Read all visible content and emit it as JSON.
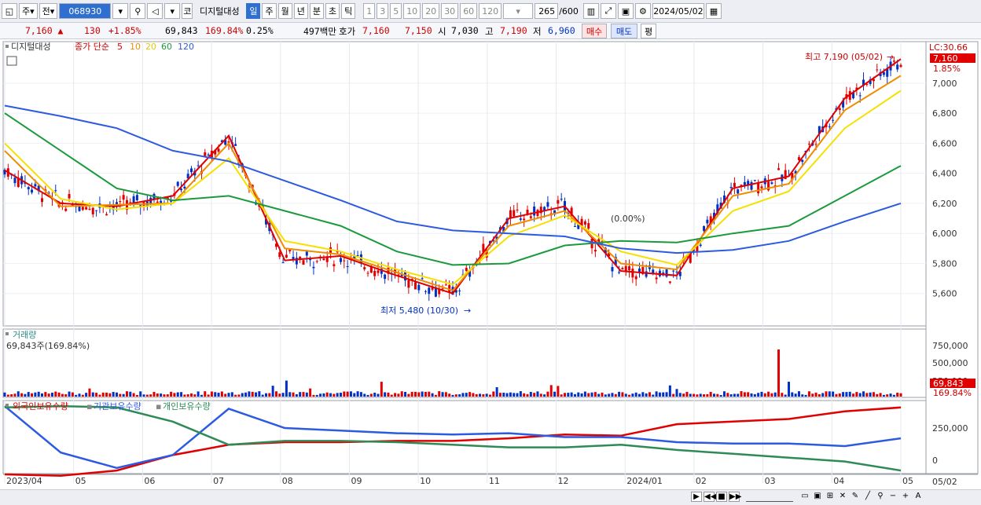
{
  "toolbar": {
    "market_type": "주",
    "market_type2": "전",
    "code": "068930",
    "name_prefix": "코",
    "name": "디지털대성",
    "periods": [
      "일",
      "주",
      "월",
      "년",
      "분",
      "초",
      "틱"
    ],
    "active_period": "일",
    "intervals": [
      "1",
      "3",
      "5",
      "10",
      "20",
      "30",
      "60",
      "120"
    ],
    "count": "265",
    "count_total": "/600",
    "date": "2024/05/02"
  },
  "quote": {
    "price": "7,160",
    "change": "130",
    "change_pct": "+1.85%",
    "volume": "69,843",
    "volume_ratio": "169.84%",
    "turnover_pct": "0.25%",
    "amount": "497백만",
    "ask_label": "호가",
    "ask": "7,160",
    "bid": "7,150",
    "open_label": "시",
    "open": "7,030",
    "high_label": "고",
    "high": "7,190",
    "low_label": "저",
    "low": "6,960",
    "buy_label": "매수",
    "sell_label": "매도",
    "eval_label": "평"
  },
  "price_panel": {
    "name": "디지털대성",
    "ma_label": "종가 단순",
    "ma_periods": [
      "5",
      "10",
      "20",
      "60",
      "120"
    ],
    "ma_colors": [
      "#e00000",
      "#f08c00",
      "#f5e000",
      "#1a9a3c",
      "#2c5ae0"
    ],
    "lc_label": "LC:30.66",
    "current_price_tag": "7,160",
    "current_pct_tag": "1.85%",
    "high_annotation": "최고 7,190 (05/02)",
    "low_annotation": "최저 5,480 (10/30)",
    "mid_annotation": "(0.00%)",
    "y_ticks": [
      "7,000",
      "6,800",
      "6,600",
      "6,400",
      "6,200",
      "6,000",
      "5,800",
      "5,600"
    ]
  },
  "volume_panel": {
    "title": "거래량",
    "current": "69,843주(169.84%)",
    "y_ticks": [
      "750,000",
      "500,000",
      "250,000"
    ],
    "tag_value": "69,843",
    "tag_pct": "169.84%"
  },
  "holding_panel": {
    "series": [
      "외국인보유수량",
      "기관보유수량",
      "개인보유수량"
    ],
    "colors": [
      "#e00000",
      "#2c5ae0",
      "#2e8b57"
    ],
    "y_ticks": [
      "250,000",
      "0"
    ]
  },
  "x_axis": {
    "labels": [
      "2023/04",
      "05",
      "06",
      "07",
      "08",
      "09",
      "10",
      "11",
      "12",
      "2024/01",
      "02",
      "03",
      "04",
      "05"
    ],
    "right_label": "05/02"
  },
  "chart_data": {
    "type": "line",
    "title": "디지털대성",
    "xlabel": "",
    "ylabel": "",
    "x": [
      "2023/04",
      "05",
      "06",
      "07",
      "08",
      "09",
      "10",
      "11",
      "12",
      "2024/01",
      "02",
      "03",
      "04",
      "05"
    ],
    "ylim": [
      5400,
      7250
    ],
    "series": [
      {
        "name": "5",
        "values": [
          6420,
          6200,
          6180,
          6250,
          6650,
          5820,
          5850,
          5720,
          5600,
          6100,
          6180,
          5750,
          5720,
          6300,
          6380,
          6900,
          7160
        ]
      },
      {
        "name": "10",
        "values": [
          6550,
          6180,
          6190,
          6200,
          6600,
          5900,
          5860,
          5740,
          5620,
          6050,
          6150,
          5800,
          5760,
          6250,
          6330,
          6820,
          7050
        ]
      },
      {
        "name": "20",
        "values": [
          6600,
          6230,
          6160,
          6200,
          6500,
          5950,
          5880,
          5760,
          5660,
          5980,
          6120,
          5880,
          5790,
          6150,
          6280,
          6700,
          6950
        ]
      },
      {
        "name": "60",
        "values": [
          6800,
          6550,
          6300,
          6220,
          6250,
          6150,
          6050,
          5880,
          5790,
          5800,
          5920,
          5950,
          5940,
          6000,
          6050,
          6250,
          6450
        ]
      },
      {
        "name": "120",
        "values": [
          6850,
          6780,
          6700,
          6550,
          6480,
          6350,
          6220,
          6080,
          6020,
          6000,
          5980,
          5900,
          5870,
          5890,
          5950,
          6080,
          6200
        ]
      }
    ]
  }
}
